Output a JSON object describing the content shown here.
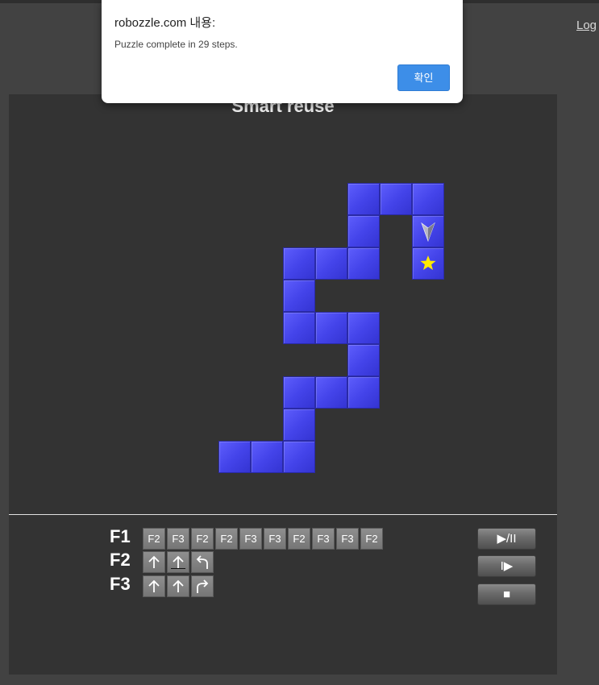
{
  "header": {
    "login_link": "Log"
  },
  "puzzle": {
    "title": "Smart reuse"
  },
  "board": {
    "tile_color": "#4a4af0",
    "star_color": "#ffeb00",
    "robot_direction": "down",
    "star_icon": "star-icon",
    "robot_icon": "robot-arrow-icon"
  },
  "program": {
    "functions": [
      {
        "label": "F1",
        "slots": [
          "F2",
          "F3",
          "F2",
          "F2",
          "F3",
          "F3",
          "F2",
          "F3",
          "F3",
          "F2"
        ]
      },
      {
        "label": "F2",
        "slots": [
          "forward",
          "forward",
          "left"
        ],
        "highlighted_slot": 1
      },
      {
        "label": "F3",
        "slots": [
          "forward",
          "forward",
          "right"
        ]
      }
    ]
  },
  "controls": {
    "play_pause": "▶/II",
    "step": "I▶",
    "stop": "■"
  },
  "dialog": {
    "title": "robozzle.com 내용:",
    "message": "Puzzle complete in 29 steps.",
    "ok_button": "확인"
  }
}
